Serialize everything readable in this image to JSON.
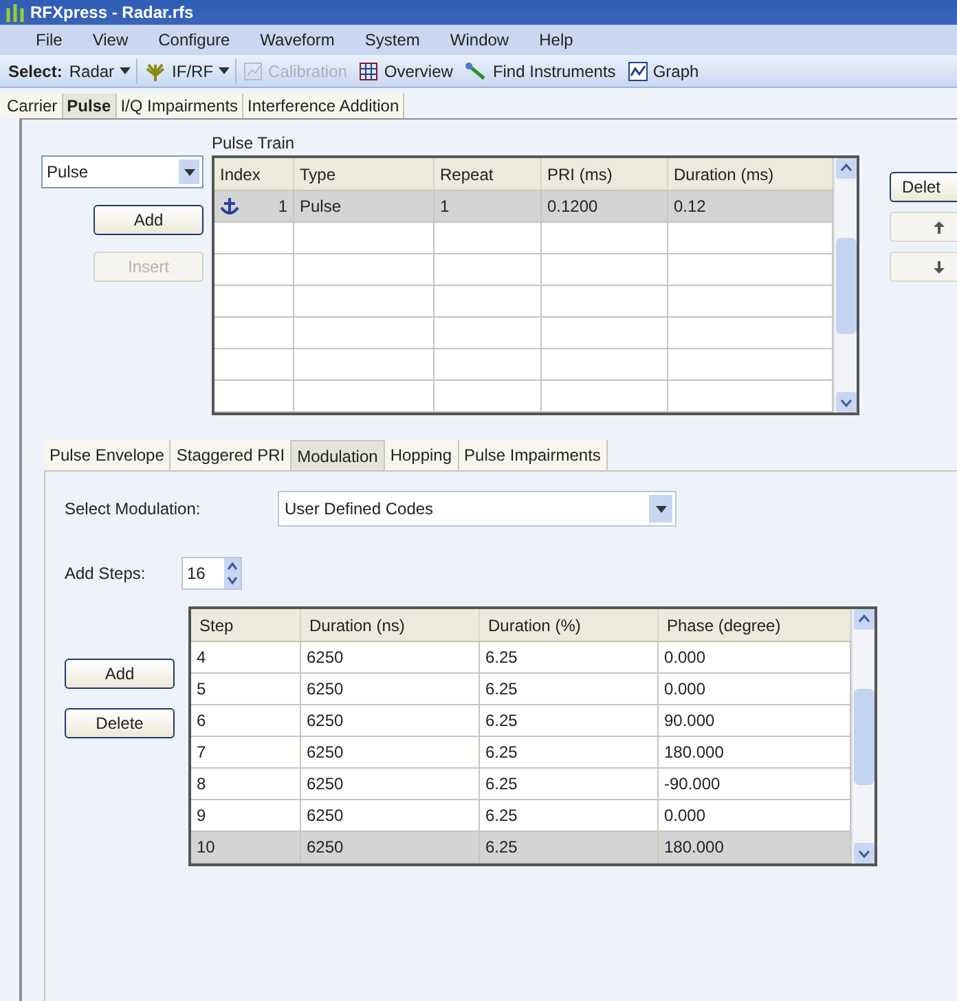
{
  "window": {
    "title": "RFXpress - Radar.rfs"
  },
  "menu": [
    "File",
    "View",
    "Configure",
    "Waveform",
    "System",
    "Window",
    "Help"
  ],
  "toolbar": [
    {
      "kind": "label",
      "label": "Select:"
    },
    {
      "kind": "dropdown",
      "label": "Radar",
      "disabled": false
    },
    {
      "kind": "dropdown",
      "label": "IF/RF",
      "disabled": false
    },
    {
      "kind": "button",
      "label": "Calibration",
      "disabled": true
    },
    {
      "kind": "button",
      "label": "Overview",
      "disabled": false
    },
    {
      "kind": "button",
      "label": "Find Instruments",
      "disabled": false
    },
    {
      "kind": "button",
      "label": "Graph",
      "disabled": false
    }
  ],
  "tabs": [
    {
      "label": "Carrier",
      "selected": false
    },
    {
      "label": "Pulse",
      "selected": true
    },
    {
      "label": "I/Q Impairments",
      "selected": false
    },
    {
      "label": "Interference Addition",
      "selected": false
    }
  ],
  "pulse_train": {
    "title": "Pulse Train",
    "type_select": "Pulse",
    "buttons": [
      {
        "label": "Add",
        "disabled": false
      },
      {
        "label": "Insert",
        "disabled": true
      }
    ],
    "columns": [
      "Index",
      "Type",
      "Repeat",
      "PRI (ms)",
      "Duration (ms)"
    ],
    "rows": [
      {
        "cells": [
          "1",
          "Pulse",
          "1",
          "0.1200",
          "0.12"
        ],
        "anchor": true,
        "selected": true
      }
    ],
    "side_buttons": [
      {
        "kind": "text",
        "label": "Delet"
      },
      {
        "kind": "up"
      },
      {
        "kind": "down"
      }
    ]
  },
  "sub_tabs": [
    {
      "label": "Pulse Envelope",
      "selected": false
    },
    {
      "label": "Staggered PRI",
      "selected": false
    },
    {
      "label": "Modulation",
      "selected": true
    },
    {
      "label": "Hopping",
      "selected": false
    },
    {
      "label": "Pulse Impairments",
      "selected": false
    }
  ],
  "modulation": {
    "select_label": "Select Modulation:",
    "select_value": "User Defined Codes",
    "steps_label": "Add Steps:",
    "steps_value": "16",
    "buttons": [
      "Add",
      "Delete"
    ],
    "columns": [
      "Step",
      "Duration (ns)",
      "Duration (%)",
      "Phase (degree)"
    ],
    "rows": [
      {
        "cells": [
          "4",
          "6250",
          "6.25",
          "0.000"
        ],
        "selected": false
      },
      {
        "cells": [
          "5",
          "6250",
          "6.25",
          "0.000"
        ],
        "selected": false
      },
      {
        "cells": [
          "6",
          "6250",
          "6.25",
          "90.000"
        ],
        "selected": false
      },
      {
        "cells": [
          "7",
          "6250",
          "6.25",
          "180.000"
        ],
        "selected": false
      },
      {
        "cells": [
          "8",
          "6250",
          "6.25",
          "-90.000"
        ],
        "selected": false
      },
      {
        "cells": [
          "9",
          "6250",
          "6.25",
          "0.000"
        ],
        "selected": false
      },
      {
        "cells": [
          "10",
          "6250",
          "6.25",
          "180.000"
        ],
        "selected": true
      }
    ]
  }
}
